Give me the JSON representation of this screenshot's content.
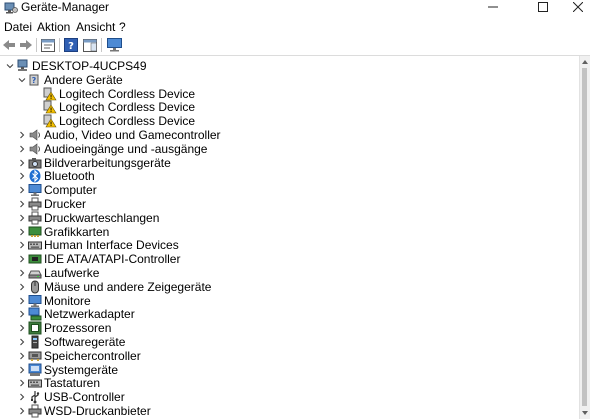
{
  "window": {
    "title": "Geräte-Manager"
  },
  "menu": [
    "Datei",
    "Aktion",
    "Ansicht",
    "?"
  ],
  "toolbar": {
    "icons": [
      "back-icon",
      "forward-icon",
      "properties-icon",
      "help-icon",
      "action-pane-icon",
      "monitor-icon"
    ]
  },
  "tree": {
    "root": {
      "label": "DESKTOP-4UCPS49",
      "expanded": true,
      "icon": "computer-icon"
    },
    "items": [
      {
        "label": "Andere Geräte",
        "level": 1,
        "expander": "expanded",
        "icon": "other-device-icon"
      },
      {
        "label": "Logitech Cordless Device",
        "level": 2,
        "expander": "none",
        "icon": "warning-device-icon"
      },
      {
        "label": "Logitech Cordless Device",
        "level": 2,
        "expander": "none",
        "icon": "warning-device-icon"
      },
      {
        "label": "Logitech Cordless Device",
        "level": 2,
        "expander": "none",
        "icon": "warning-device-icon"
      },
      {
        "label": "Audio, Video und Gamecontroller",
        "level": 1,
        "expander": "collapsed",
        "icon": "speaker-icon"
      },
      {
        "label": "Audioeingänge und -ausgänge",
        "level": 1,
        "expander": "collapsed",
        "icon": "speaker-icon"
      },
      {
        "label": "Bildverarbeitungsgeräte",
        "level": 1,
        "expander": "collapsed",
        "icon": "camera-icon"
      },
      {
        "label": "Bluetooth",
        "level": 1,
        "expander": "collapsed",
        "icon": "bluetooth-icon"
      },
      {
        "label": "Computer",
        "level": 1,
        "expander": "collapsed",
        "icon": "monitor-icon"
      },
      {
        "label": "Drucker",
        "level": 1,
        "expander": "collapsed",
        "icon": "printer-icon"
      },
      {
        "label": "Druckwarteschlangen",
        "level": 1,
        "expander": "collapsed",
        "icon": "printer-icon"
      },
      {
        "label": "Grafikkarten",
        "level": 1,
        "expander": "collapsed",
        "icon": "display-adapter-icon"
      },
      {
        "label": "Human Interface Devices",
        "level": 1,
        "expander": "collapsed",
        "icon": "keyboard-icon"
      },
      {
        "label": "IDE ATA/ATAPI-Controller",
        "level": 1,
        "expander": "collapsed",
        "icon": "controller-icon"
      },
      {
        "label": "Laufwerke",
        "level": 1,
        "expander": "collapsed",
        "icon": "drive-icon"
      },
      {
        "label": "Mäuse und andere Zeigegeräte",
        "level": 1,
        "expander": "collapsed",
        "icon": "mouse-icon"
      },
      {
        "label": "Monitore",
        "level": 1,
        "expander": "collapsed",
        "icon": "monitor-icon"
      },
      {
        "label": "Netzwerkadapter",
        "level": 1,
        "expander": "collapsed",
        "icon": "network-icon"
      },
      {
        "label": "Prozessoren",
        "level": 1,
        "expander": "collapsed",
        "icon": "processor-icon"
      },
      {
        "label": "Softwaregeräte",
        "level": 1,
        "expander": "collapsed",
        "icon": "software-device-icon"
      },
      {
        "label": "Speichercontroller",
        "level": 1,
        "expander": "collapsed",
        "icon": "storage-controller-icon"
      },
      {
        "label": "Systemgeräte",
        "level": 1,
        "expander": "collapsed",
        "icon": "system-device-icon"
      },
      {
        "label": "Tastaturen",
        "level": 1,
        "expander": "collapsed",
        "icon": "keyboard-icon"
      },
      {
        "label": "USB-Controller",
        "level": 1,
        "expander": "collapsed",
        "icon": "usb-icon"
      },
      {
        "label": "WSD-Druckanbieter",
        "level": 1,
        "expander": "collapsed",
        "icon": "printer-icon"
      }
    ]
  }
}
